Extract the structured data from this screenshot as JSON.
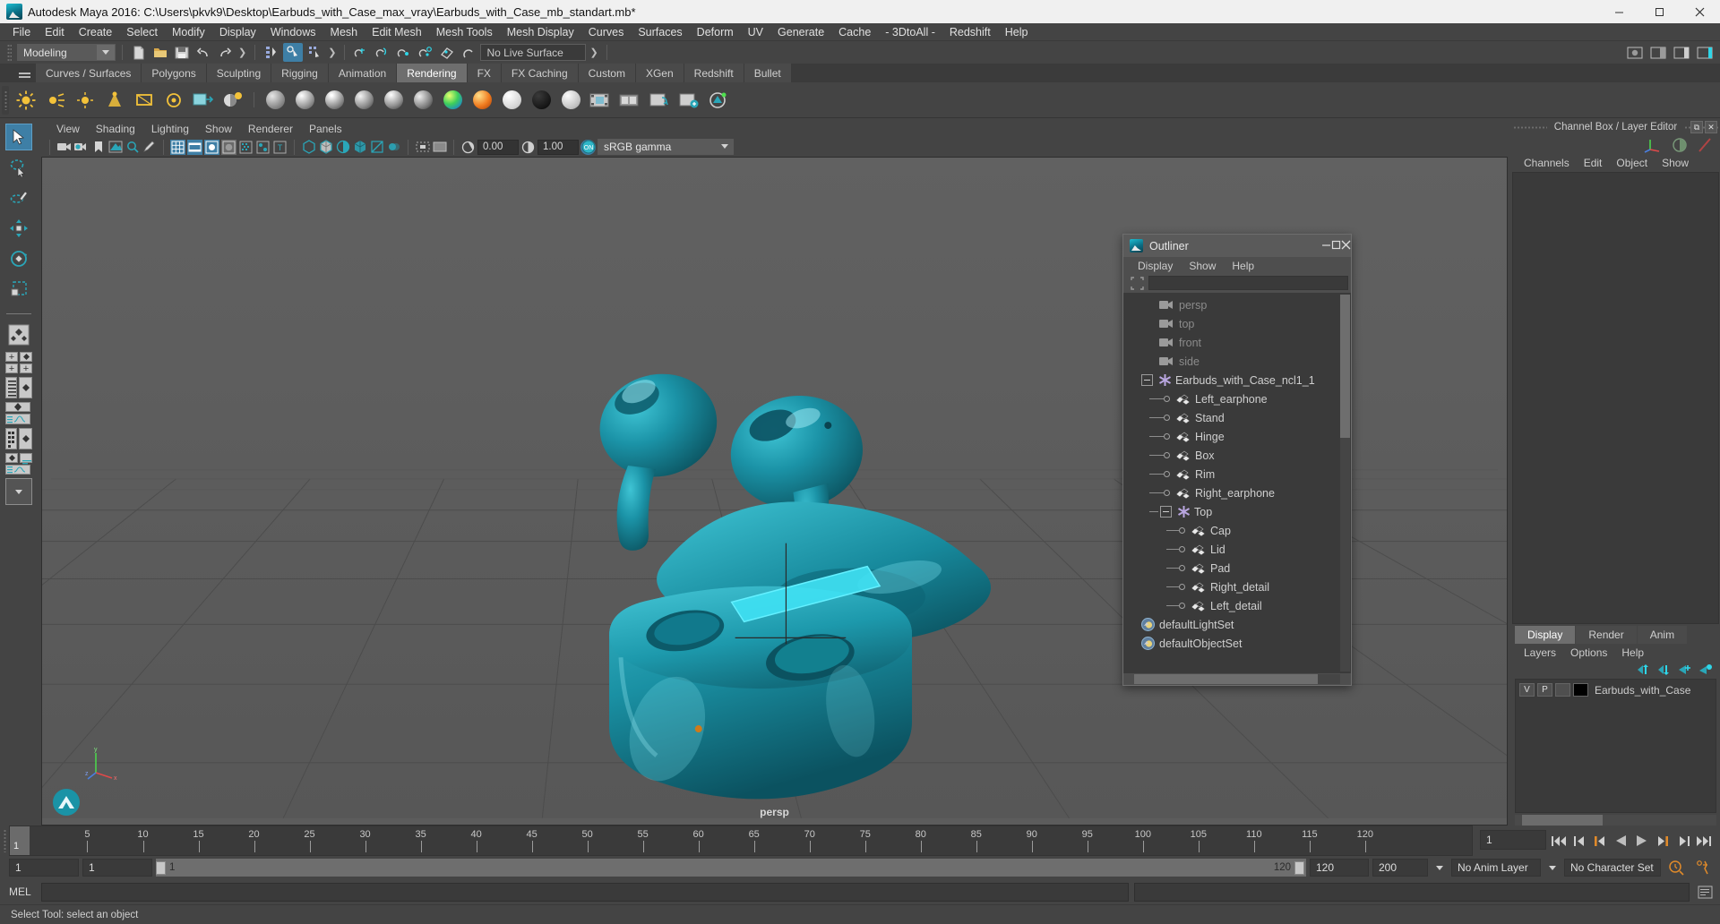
{
  "window": {
    "title": "Autodesk Maya 2016: C:\\Users\\pkvk9\\Desktop\\Earbuds_with_Case_max_vray\\Earbuds_with_Case_mb_standart.mb*",
    "minimize": "—",
    "maximize": "❐",
    "close": "✕"
  },
  "menubar": {
    "items": [
      "File",
      "Edit",
      "Create",
      "Select",
      "Modify",
      "Display",
      "Windows",
      "Mesh",
      "Edit Mesh",
      "Mesh Tools",
      "Mesh Display",
      "Curves",
      "Surfaces",
      "Deform",
      "UV",
      "Generate",
      "Cache",
      "- 3DtoAll -",
      "Redshift",
      "Help"
    ]
  },
  "statusline": {
    "menuset": "Modeling",
    "live_surface": "No Live Surface"
  },
  "shelf": {
    "tabs": [
      "Curves / Surfaces",
      "Polygons",
      "Sculpting",
      "Rigging",
      "Animation",
      "Rendering",
      "FX",
      "FX Caching",
      "Custom",
      "XGen",
      "Redshift",
      "Bullet"
    ],
    "active_tab": "Rendering"
  },
  "viewport": {
    "menus": [
      "View",
      "Shading",
      "Lighting",
      "Show",
      "Renderer",
      "Panels"
    ],
    "exposure": "0.00",
    "gamma": "1.00",
    "color_management": "sRGB gamma",
    "camera_label": "persp",
    "axis": {
      "x": "x",
      "y": "y",
      "z": "z"
    }
  },
  "outliner": {
    "title": "Outliner",
    "minimize": "—",
    "maximize": "❐",
    "close": "✕",
    "menus": [
      "Display",
      "Show",
      "Help"
    ],
    "search_value": "",
    "items": [
      {
        "label": "persp",
        "type": "camera",
        "indent": 0,
        "dim": true
      },
      {
        "label": "top",
        "type": "camera",
        "indent": 0,
        "dim": true
      },
      {
        "label": "front",
        "type": "camera",
        "indent": 0,
        "dim": true
      },
      {
        "label": "side",
        "type": "camera",
        "indent": 0,
        "dim": true
      },
      {
        "label": "Earbuds_with_Case_ncl1_1",
        "type": "group",
        "indent": 0,
        "expanded": true
      },
      {
        "label": "Left_earphone",
        "type": "mesh",
        "indent": 1
      },
      {
        "label": "Stand",
        "type": "mesh",
        "indent": 1
      },
      {
        "label": "Hinge",
        "type": "mesh",
        "indent": 1
      },
      {
        "label": "Box",
        "type": "mesh",
        "indent": 1
      },
      {
        "label": "Rim",
        "type": "mesh",
        "indent": 1
      },
      {
        "label": "Right_earphone",
        "type": "mesh",
        "indent": 1
      },
      {
        "label": "Top",
        "type": "group",
        "indent": 1,
        "expanded": true
      },
      {
        "label": "Cap",
        "type": "mesh",
        "indent": 2
      },
      {
        "label": "Lid",
        "type": "mesh",
        "indent": 2
      },
      {
        "label": "Pad",
        "type": "mesh",
        "indent": 2
      },
      {
        "label": "Right_detail",
        "type": "mesh",
        "indent": 2
      },
      {
        "label": "Left_detail",
        "type": "mesh",
        "indent": 2
      },
      {
        "label": "defaultLightSet",
        "type": "set",
        "indent": 0
      },
      {
        "label": "defaultObjectSet",
        "type": "set",
        "indent": 0
      }
    ]
  },
  "channelbox": {
    "title": "Channel Box / Layer Editor",
    "menus": [
      "Channels",
      "Edit",
      "Object",
      "Show"
    ]
  },
  "layereditor": {
    "tabs": [
      "Display",
      "Render",
      "Anim"
    ],
    "active_tab": "Display",
    "menus": [
      "Layers",
      "Options",
      "Help"
    ],
    "rows": [
      {
        "visibility": "V",
        "playback": "P",
        "reference": "",
        "color": "#000000",
        "name": "Earbuds_with_Case"
      }
    ]
  },
  "timeline": {
    "start_frame": "1",
    "current_frame": "1",
    "ticks": [
      "5",
      "10",
      "15",
      "20",
      "25",
      "30",
      "35",
      "40",
      "45",
      "50",
      "55",
      "60",
      "65",
      "70",
      "75",
      "80",
      "85",
      "90",
      "95",
      "100",
      "105",
      "110",
      "115",
      "120"
    ],
    "range_start": "1",
    "range_end": "1",
    "slider_min": "1",
    "slider_max": "120",
    "playback_end": "120",
    "anim_end": "200",
    "anim_layer": "No Anim Layer",
    "character_set": "No Character Set"
  },
  "command_line": {
    "language": "MEL",
    "input_value": "",
    "output_value": ""
  },
  "helpline": {
    "text": "Select Tool: select an object"
  },
  "colors": {
    "accent_blue": "#3e7fa6",
    "teal": "#19a6b8",
    "model_teal": "#1a8fa3",
    "panel_bg": "#444444",
    "dark_bg": "#3a3a3a",
    "viewport_bg": "#5c5c5c",
    "selection_cyan": "#2fd6e8",
    "orange": "#e08a2a"
  }
}
